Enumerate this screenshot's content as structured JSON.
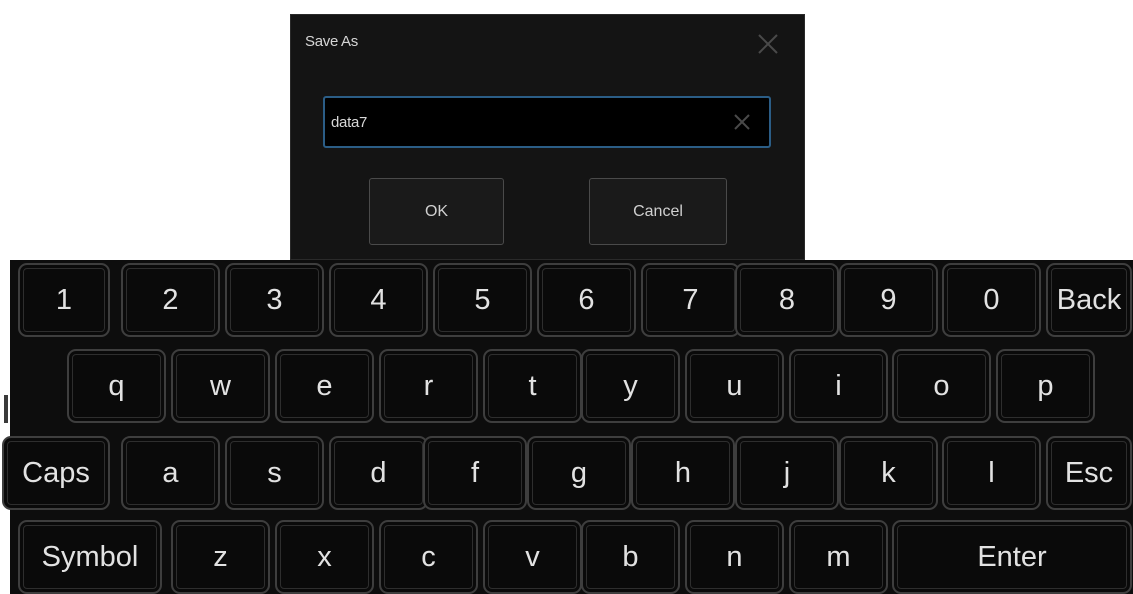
{
  "dialog": {
    "title": "Save As",
    "close_icon": "close-icon",
    "filename_value": "data7",
    "clear_icon": "clear-icon",
    "ok_label": "OK",
    "cancel_label": "Cancel"
  },
  "keyboard": {
    "row1": [
      "1",
      "2",
      "3",
      "4",
      "5",
      "6",
      "7",
      "8",
      "9",
      "0",
      "Back"
    ],
    "row2": [
      "q",
      "w",
      "e",
      "r",
      "t",
      "y",
      "u",
      "i",
      "o",
      "p"
    ],
    "row3": [
      "Caps",
      "a",
      "s",
      "d",
      "f",
      "g",
      "h",
      "j",
      "k",
      "l",
      "Esc"
    ],
    "row4": [
      "Symbol",
      "z",
      "x",
      "c",
      "v",
      "b",
      "n",
      "m",
      "Enter"
    ]
  },
  "colors": {
    "dialog_bg": "#141414",
    "keyboard_bg": "#0d0d0d",
    "input_border": "#2b5d86",
    "key_text": "#e2e2e2"
  }
}
